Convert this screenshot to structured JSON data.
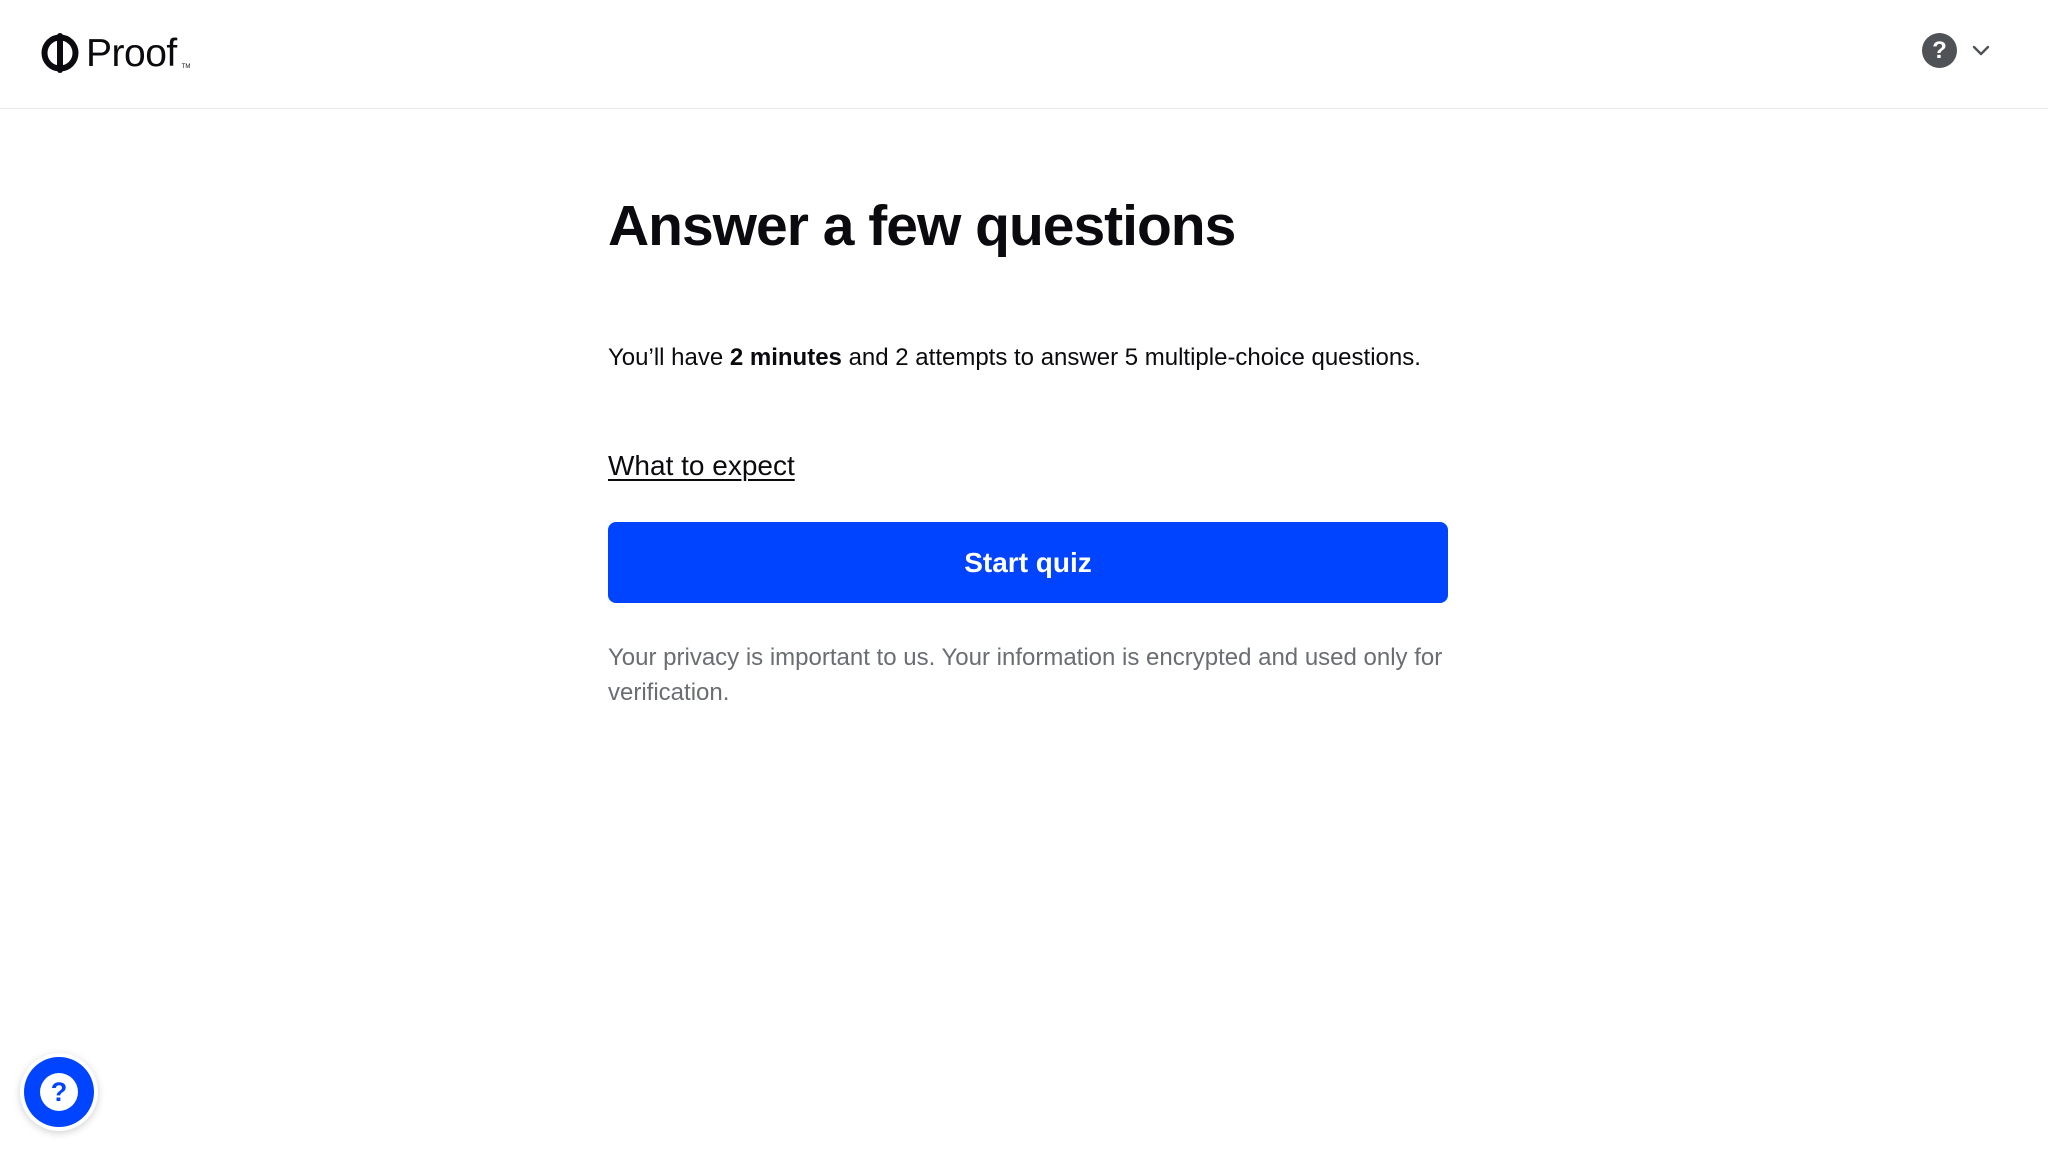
{
  "header": {
    "logo_text": "Proof",
    "logo_tm": "TM",
    "help_icon_glyph": "?",
    "help_icon": "question-circle-icon",
    "menu_icon": "chevron-down-icon"
  },
  "main": {
    "title": "Answer a few questions",
    "intro_prefix": "You’ll have ",
    "intro_bold": "2 minutes",
    "intro_suffix": " and 2 attempts to answer 5 multiple-choice questions.",
    "expect_link": "What to expect",
    "start_button": "Start quiz",
    "privacy_text": "Your privacy is important to us. Your information is encrypted and used only for verification."
  },
  "floating_help": {
    "glyph": "?",
    "icon": "question-circle-icon"
  },
  "colors": {
    "accent": "#0044ff",
    "text": "#0b0b0f",
    "muted_text": "#6a6d72",
    "help_icon_bg": "#4f5256",
    "divider": "#e6e7ea"
  }
}
